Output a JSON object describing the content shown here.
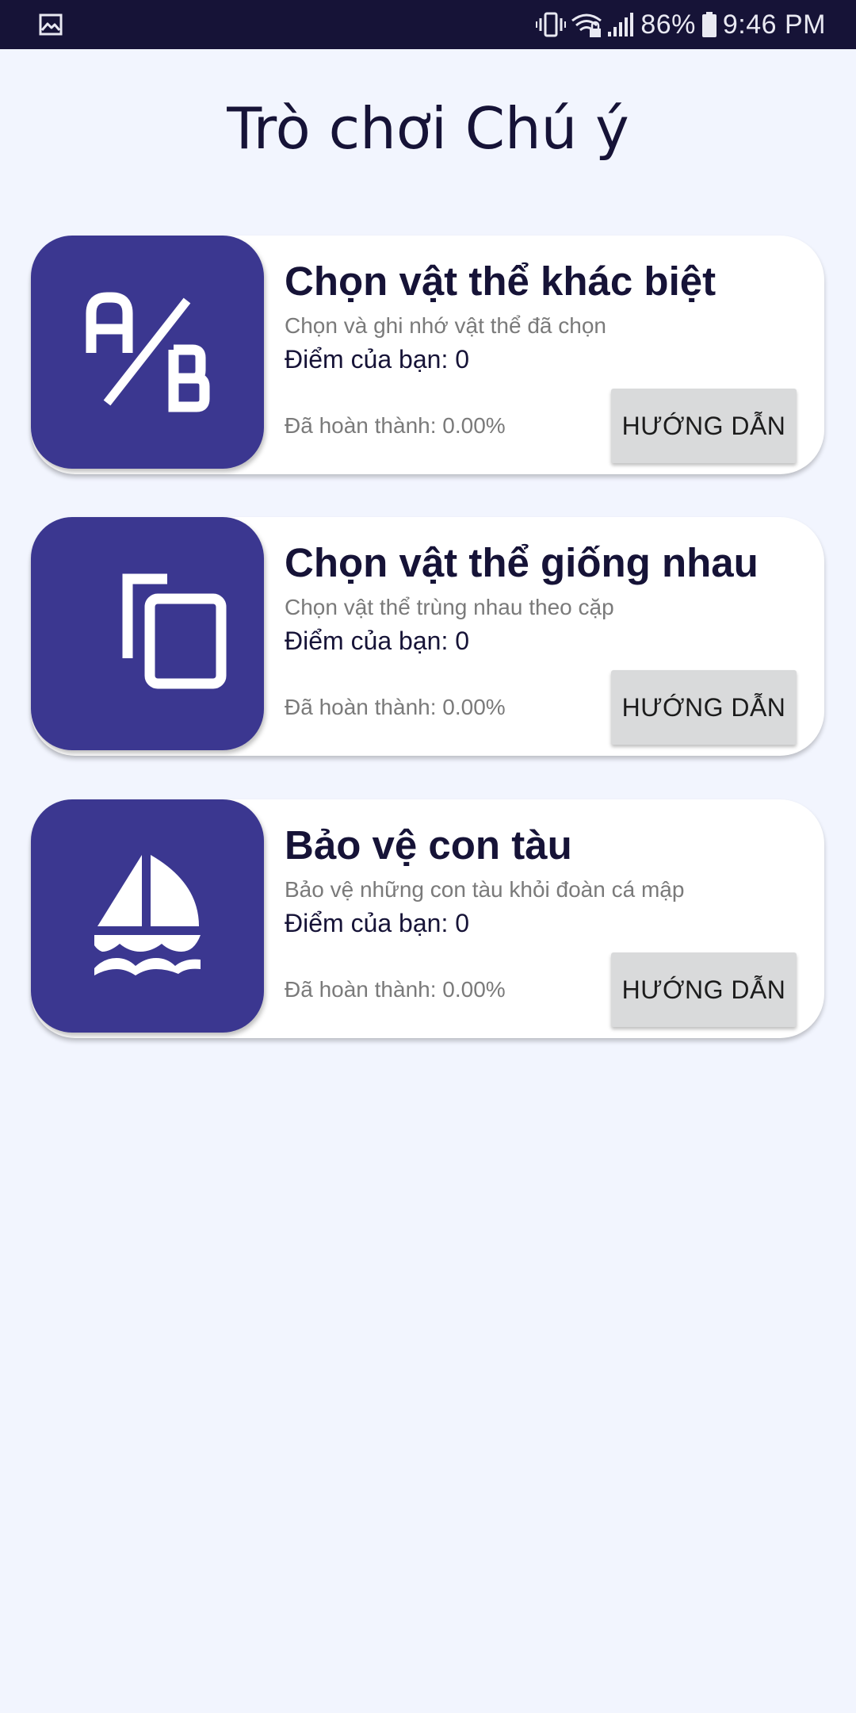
{
  "status_bar": {
    "left_icon": "image-icon",
    "right_icons": [
      "vibrate-icon",
      "wifi-icon",
      "signal-icon",
      "battery-icon"
    ],
    "battery": "86%",
    "time": "9:46 PM"
  },
  "page": {
    "title": "Trò chơi Chú ý"
  },
  "games": [
    {
      "icon": "ab-compare-icon",
      "title": "Chọn vật thể khác biệt",
      "description": "Chọn và ghi nhớ vật thể đã chọn",
      "score": "Điểm của bạn: 0",
      "progress": "Đã hoàn thành: 0.00%",
      "button": "HƯỚNG DẪN"
    },
    {
      "icon": "copy-icon",
      "title": "Chọn vật thể giống nhau",
      "description": "Chọn vật thể trùng nhau theo cặp",
      "score": "Điểm của bạn: 0",
      "progress": "Đã hoàn thành: 0.00%",
      "button": "HƯỚNG DẪN"
    },
    {
      "icon": "sailboat-icon",
      "title": "Bảo vệ con tàu",
      "description": "Bảo vệ những con tàu khỏi đoàn cá mập",
      "score": "Điểm của bạn: 0",
      "progress": "Đã hoàn thành: 0.00%",
      "button": "HƯỚNG DẪN"
    }
  ],
  "colors": {
    "status_bar": "#161337",
    "background": "#f2f5fe",
    "thumbnail": "#3b3790",
    "title_text": "#161337",
    "secondary_text": "#7a7a7a",
    "button_bg": "#d9dadb"
  }
}
